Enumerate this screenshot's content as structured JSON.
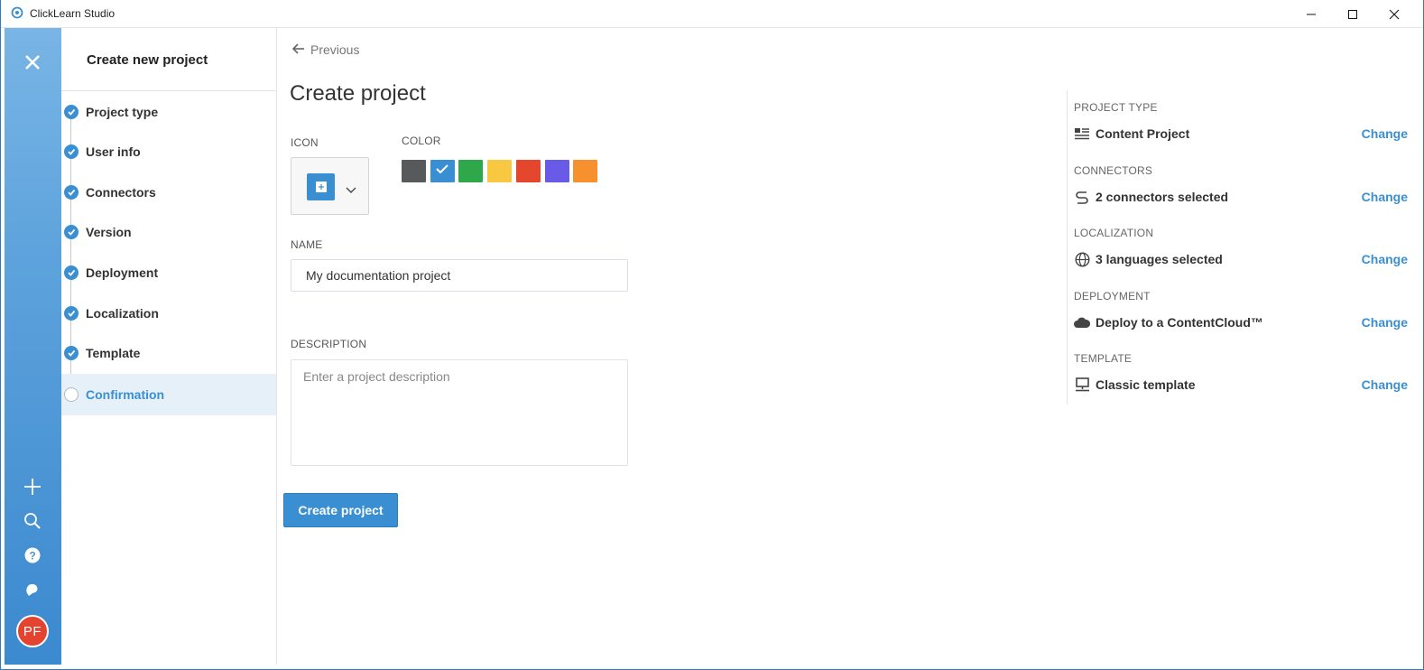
{
  "window": {
    "title": "ClickLearn Studio"
  },
  "rail": {
    "avatar_initials": "PF",
    "icons": [
      "close-icon",
      "plus-icon",
      "search-icon",
      "help-icon",
      "chat-icon"
    ]
  },
  "steps": {
    "heading": "Create new project",
    "items": [
      {
        "label": "Project type",
        "done": true
      },
      {
        "label": "User info",
        "done": true
      },
      {
        "label": "Connectors",
        "done": true
      },
      {
        "label": "Version",
        "done": true
      },
      {
        "label": "Deployment",
        "done": true
      },
      {
        "label": "Localization",
        "done": true
      },
      {
        "label": "Template",
        "done": true
      },
      {
        "label": "Confirmation",
        "done": false,
        "active": true
      }
    ]
  },
  "main": {
    "previous_label": "Previous",
    "title": "Create project",
    "icon_label": "ICON",
    "color_label": "COLOR",
    "colors": [
      "#58595b",
      "#3a8fd3",
      "#2ea84a",
      "#f8c843",
      "#e5462e",
      "#6a5ae8",
      "#f7912f"
    ],
    "selected_color": "#3a8fd3",
    "name_label": "NAME",
    "name_value": "My documentation project",
    "description_label": "DESCRIPTION",
    "description_placeholder": "Enter a project description",
    "create_button": "Create project"
  },
  "summary": {
    "change_label": "Change",
    "sections": [
      {
        "label": "PROJECT TYPE",
        "value": "Content Project",
        "icon": "list-icon"
      },
      {
        "label": "CONNECTORS",
        "value": "2 connectors selected",
        "icon": "connector-icon"
      },
      {
        "label": "LOCALIZATION",
        "value": "3 languages selected",
        "icon": "globe-icon"
      },
      {
        "label": "DEPLOYMENT",
        "value": "Deploy to a ContentCloud™",
        "icon": "cloud-icon"
      },
      {
        "label": "TEMPLATE",
        "value": "Classic template",
        "icon": "monitor-icon"
      }
    ]
  }
}
